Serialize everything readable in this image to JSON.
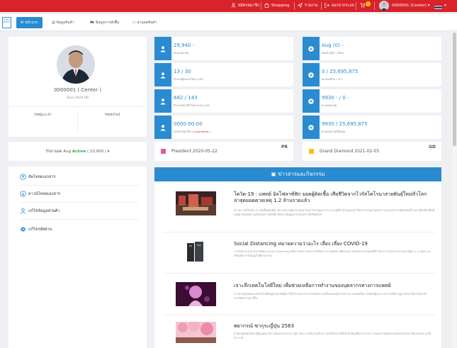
{
  "topbar": {
    "register": "สมัครสมาชิก",
    "shopping": "Shopping",
    "report": "รายงาน",
    "logout": "ออกจากระบบ",
    "cart_badge": "1",
    "user": "0000001 (Center)"
  },
  "logo": {
    "text": "EDEN WORLD"
  },
  "nav": {
    "tabs": [
      {
        "label": "หน้าแรก"
      },
      {
        "label": "ข้อมูลสินค้า"
      },
      {
        "label": "ข้อมูลการสั่งซื้อ"
      },
      {
        "label": "ส่วนลดสินค้า"
      }
    ]
  },
  "profile": {
    "name": "0000001 ( Center )",
    "plan": "Dyeo MLM DB",
    "left_label": "รหัสผู้แนะนำ",
    "left_value": "-",
    "right_label": "รหัสอัพไลน์",
    "right_value": "-",
    "maintain_prefix": "รักษายอด Aug",
    "maintain_status": "Active",
    "maintain_pv": "( 10,000 )"
  },
  "stats_left": [
    {
      "value": "29,940 -",
      "label": "คะแนนสะสม"
    },
    {
      "value": "13 / 30",
      "label": "จำนวนผู้แนะนำตรง (L/R)"
    },
    {
      "value": "682 / 143",
      "label": "จำนวนสมาชิกในสายงาน (L/R)"
    },
    {
      "value": "0000-00-00",
      "label": "เอกสารสมาชิก",
      "warn": "( incomplete )"
    }
  ],
  "stats_right": [
    {
      "value": "Aug (0) -",
      "label": "ยอดส่วนตัว / เดือน"
    },
    {
      "value": "0 / 25,695,875",
      "label": "คะแนนซ้าย / ขวา"
    },
    {
      "value": "9930 - / 0 -",
      "label": "คะแนนสะสม"
    },
    {
      "value": "9930 / 25,695,875",
      "label": "คะแนนสะสมทั้งหมด"
    }
  ],
  "rank_left": {
    "tag": "PR",
    "text": "President 2020-05-22"
  },
  "rank_right": {
    "tag": "GD",
    "text": "Grand Diamond 2021-02-05"
  },
  "menu": {
    "items": [
      {
        "label": "อัพโหลดเอกสาร"
      },
      {
        "label": "ดาวน์โหลดเอกสาร"
      },
      {
        "label": "แก้ไขข้อมูลส่วนตัว"
      },
      {
        "label": "แก้ไขรหัสผ่าน"
      }
    ]
  },
  "news": {
    "header": "ข่าวสารและกิจกรรม",
    "items": [
      {
        "title": "โควิด-19 : แพทย์ อิลโฟลาซ์ฟิก ยอดผู้ติดเชื้อ เสียชีวิตจากไวรัสโคโรนาสายพันธุ์ใหม่ทั่วโลก ล่าสุดยอดตายเหตุ 1.2 ล้านรายแล้ว",
        "body": "สถานการณ์โควิด-19 เพิ่มขึ้นต่อเนื่อง หลายประเทศยกระดับมาตรการควบคุมการระบาด ผู้เชี่ยวชาญแนะนำให้ประชาชนสวมหน้ากากอนามัย ล้างมือบ่อยครั้ง และหลีกเลี่ยงพื้นที่แออัด เพื่อลดความเสี่ยงในการติดเชื้อ ติดตามข้อมูลจากแหล่งข่าวที่เชื่อถือได้"
      },
      {
        "title": "Social Distancing หมายความว่าอะไร เลี่ยง เลี่ยง COVID-19",
        "body": "การรักษาระยะห่างทางสังคม Social Distancing คือการลดการพบปะใกล้ชิดระหว่างบุคคล เพื่อชะลอการแพร่ระบาดของเชื้อไวรัส ควรเว้นระยะห่างอย่างน้อย 1-2 เมตร และหลีกเลี่ยงการชุมนุมในที่สาธารณะ"
      },
      {
        "title": "เจาะลึกเทคโนโลยีใหม่ เพื่อช่วยเหลือการทำงานของบุคลากรทางการแพทย์",
        "body": "การนำหุ่นยนต์และเทคโนโลยีปัญญาประดิษฐ์มาใช้ในโรงพยาบาล ช่วยลดความเสี่ยงของบุคลากรทางการแพทย์ในการสัมผัสผู้ป่วย และช่วยให้การดูแลรักษาเป็นไปอย่างมีประสิทธิภาพมากขึ้น"
      },
      {
        "title": "พยากรณ์ ซากุระญี่ปุ่น 2563",
        "body": "สำนักอุตุนิยมวิทยาญี่ปุ่นเผยคาดการณ์ดอกซากุระบานปี 2563 จะเริ่มบานเร็วกว่าปกติในหลายพื้นที่ นักท่องเที่ยวสามารถวางแผนการเดินทางชมดอกซากุระได้ตามช่วงเวลาที่ประกาศ"
      }
    ]
  }
}
